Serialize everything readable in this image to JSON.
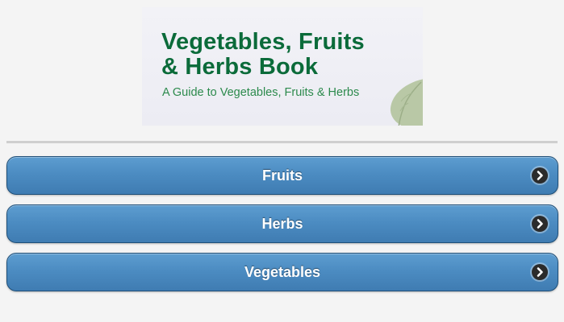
{
  "banner": {
    "title_line1": "Vegetables, Fruits",
    "title_line2": "& Herbs Book",
    "subtitle": "A Guide to Vegetables, Fruits & Herbs"
  },
  "menu": {
    "items": [
      {
        "label": "Fruits",
        "icon": "chevron-right-icon"
      },
      {
        "label": "Herbs",
        "icon": "chevron-right-icon"
      },
      {
        "label": "Vegetables",
        "icon": "chevron-right-icon"
      }
    ]
  },
  "colors": {
    "title_green": "#0b6b3a",
    "button_blue": "#4c8cc2"
  }
}
